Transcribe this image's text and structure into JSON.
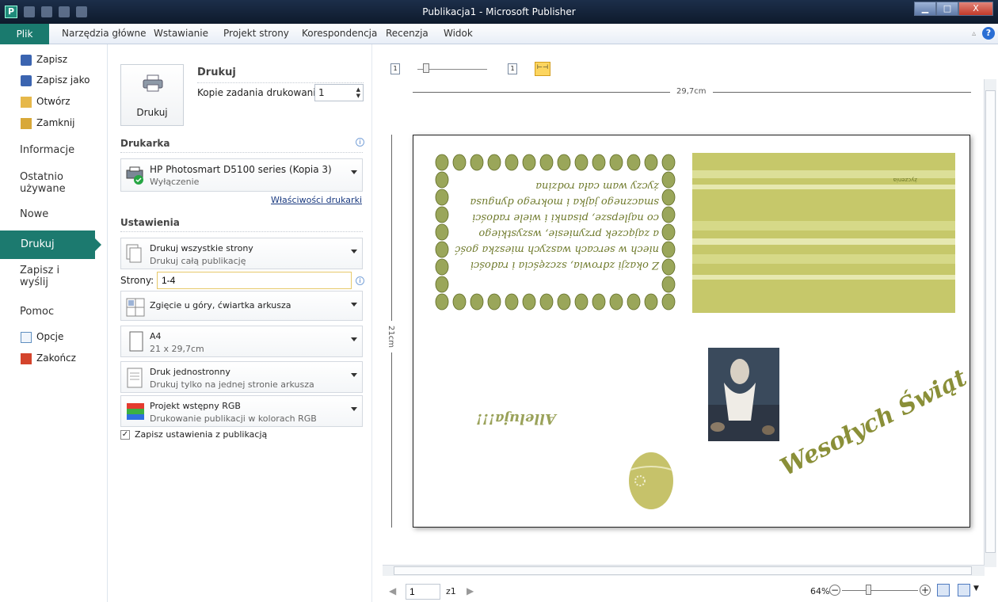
{
  "window": {
    "app_letter": "P",
    "title": "Publikacja1 - Microsoft Publisher",
    "min": "▁",
    "max": "□",
    "close": "X"
  },
  "ribbon": {
    "tabs": [
      "Plik",
      "Narzędzia główne",
      "Wstawianie",
      "Projekt strony",
      "Korespondencja",
      "Recenzja",
      "Widok"
    ],
    "help": "?",
    "caret": "▵"
  },
  "backstage_nav": {
    "save": "Zapisz",
    "save_as": "Zapisz jako",
    "open": "Otwórz",
    "close": "Zamknij",
    "info": "Informacje",
    "recent_line1": "Ostatnio",
    "recent_line2": "używane",
    "new": "Nowe",
    "print": "Drukuj",
    "send_line1": "Zapisz i",
    "send_line2": "wyślij",
    "help": "Pomoc",
    "options": "Opcje",
    "exit": "Zakończ"
  },
  "print_panel": {
    "heading": "Drukuj",
    "print_button": "Drukuj",
    "copies_label": "Kopie zadania drukowania:",
    "copies_value": "1",
    "printer_section": "Drukarka",
    "printer_name": "HP Photosmart D5100 series (Kopia 3)",
    "printer_status": "Wyłączenie",
    "printer_properties": "Właściwości drukarki",
    "settings_section": "Ustawienia",
    "pages_option_title": "Drukuj wszystkie strony",
    "pages_option_desc": "Drukuj całą publikację",
    "pages_label": "Strony:",
    "pages_value": "1-4",
    "fold_option": "Zgięcie u góry, ćwiartka arkusza",
    "paper_title": "A4",
    "paper_desc": "21 x 29,7cm",
    "sides_title": "Druk jednostronny",
    "sides_desc": "Drukuj tylko na jednej stronie arkusza",
    "color_title": "Projekt wstępny RGB",
    "color_desc": "Drukowanie publikacji w kolorach RGB",
    "save_settings": "Zapisz ustawienia z publikacją",
    "info": "i",
    "checkmark": "✓"
  },
  "preview": {
    "width_label": "29,7cm",
    "height_label": "21cm",
    "page_value": "1",
    "page_of": "z1",
    "zoom": "64%",
    "card": {
      "poem_lines": [
        "Z okazji zdrowia, szczęścia i radości",
        "niech w sercach waszych mieszka gość",
        "a zajączek przyniesie, wszystkiego",
        "co najlepsze, pisanki i wiele radości",
        "smacznego jajka i mokrego dyngusa",
        "życzy wam cała rodzina"
      ],
      "greeting": "Wesołych Świąt",
      "small_text": "Alleluja!!!",
      "banner_label": "życzenia"
    },
    "colors": {
      "accent_green": "#1c7a6f",
      "olive": "#c6c86a",
      "olive_dark": "#6f7a2c"
    }
  }
}
